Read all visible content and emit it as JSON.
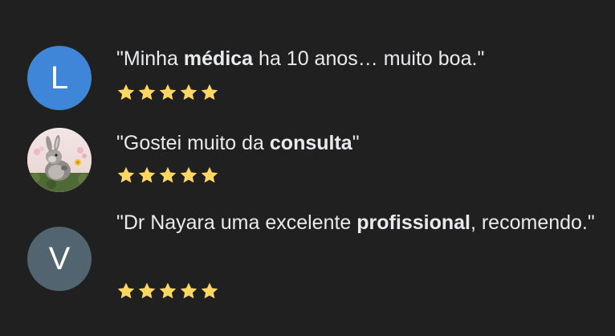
{
  "colors": {
    "background": "#202020",
    "text": "#e8eaed",
    "star": "#fdd663",
    "avatar_l": "#3f86d8",
    "avatar_v": "#516470"
  },
  "reviews": [
    {
      "avatar": {
        "type": "letter",
        "letter": "L",
        "color": "#3f86d8"
      },
      "quote_open": "\"Minha ",
      "bold": "médica",
      "quote_close": " ha 10 anos… muito boa.\"",
      "rating": 5
    },
    {
      "avatar": {
        "type": "photo",
        "icon": "rabbit-photo-icon"
      },
      "quote_open": "\"Gostei muito da ",
      "bold": "consulta",
      "quote_close": "\"",
      "rating": 5
    },
    {
      "avatar": {
        "type": "letter",
        "letter": "V",
        "color": "#516470"
      },
      "quote_open": "\"Dr Nayara uma excelente ",
      "bold": "profissional",
      "quote_close": ", recomendo.\"",
      "rating": 5
    }
  ]
}
